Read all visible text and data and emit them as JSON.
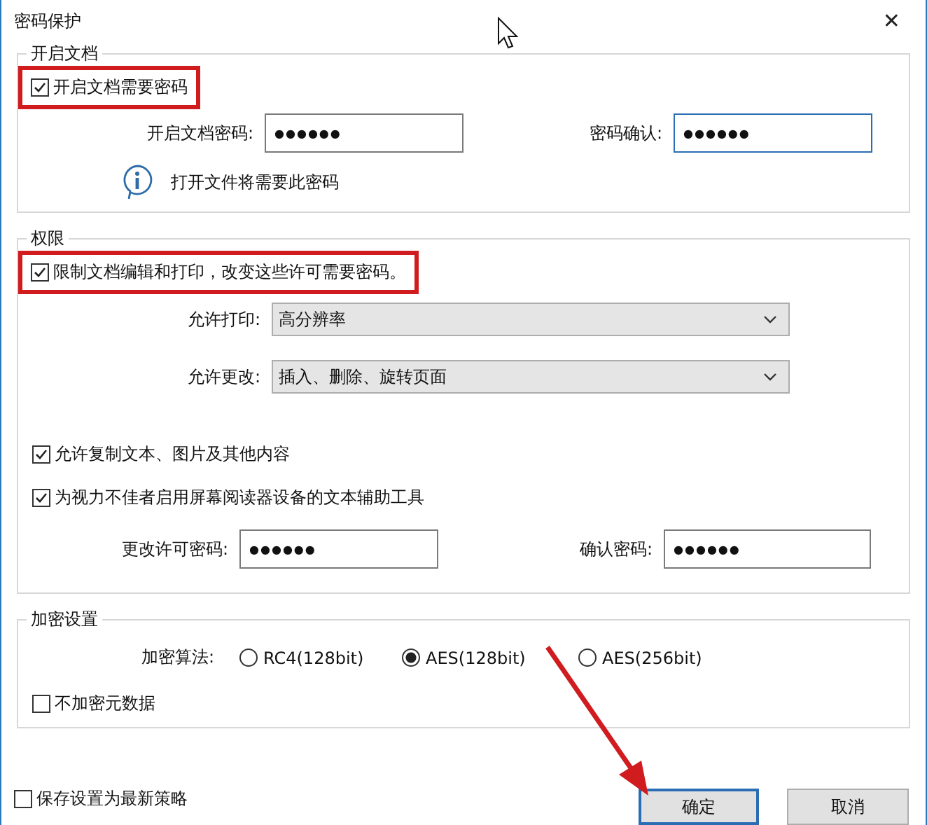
{
  "window": {
    "title": "密码保护",
    "close": "✕"
  },
  "open_group": {
    "title": "开启文档",
    "require": {
      "label": "开启文档需要密码",
      "checked": true,
      "highlighted": true
    },
    "fields": [
      {
        "label": "开启文档密码:",
        "value": "●●●●●●",
        "focused": false
      },
      {
        "label": "密码确认:",
        "value": "●●●●●●",
        "focused": true
      }
    ],
    "info": "打开文件将需要此密码"
  },
  "permissions_group": {
    "title": "权限",
    "restrict": {
      "label": "限制文档编辑和打印，改变这些许可需要密码。",
      "checked": true,
      "highlighted": true
    },
    "selects": [
      {
        "label": "允许打印:",
        "value": "高分辨率"
      },
      {
        "label": "允许更改:",
        "value": "插入、删除、旋转页面"
      }
    ],
    "options": [
      {
        "label": "允许复制文本、图片及其他内容",
        "checked": true
      },
      {
        "label": "为视力不佳者启用屏幕阅读器设备的文本辅助工具",
        "checked": true
      }
    ],
    "fields": [
      {
        "label": "更改许可密码:",
        "value": "●●●●●●",
        "focused": false
      },
      {
        "label": "确认密码:",
        "value": "●●●●●●",
        "focused": false
      }
    ]
  },
  "encryption_group": {
    "title": "加密设置",
    "algorithm_label": "加密算法:",
    "algorithms": [
      {
        "label": "RC4(128bit)",
        "selected": false
      },
      {
        "label": "AES(128bit)",
        "selected": true
      },
      {
        "label": "AES(256bit)",
        "selected": false
      }
    ],
    "metadata": {
      "label": "不加密元数据",
      "checked": false
    }
  },
  "save_policy": {
    "label": "保存设置为最新策略",
    "checked": false
  },
  "buttons": [
    {
      "label": "确定",
      "default": true
    },
    {
      "label": "取消",
      "default": false
    }
  ]
}
